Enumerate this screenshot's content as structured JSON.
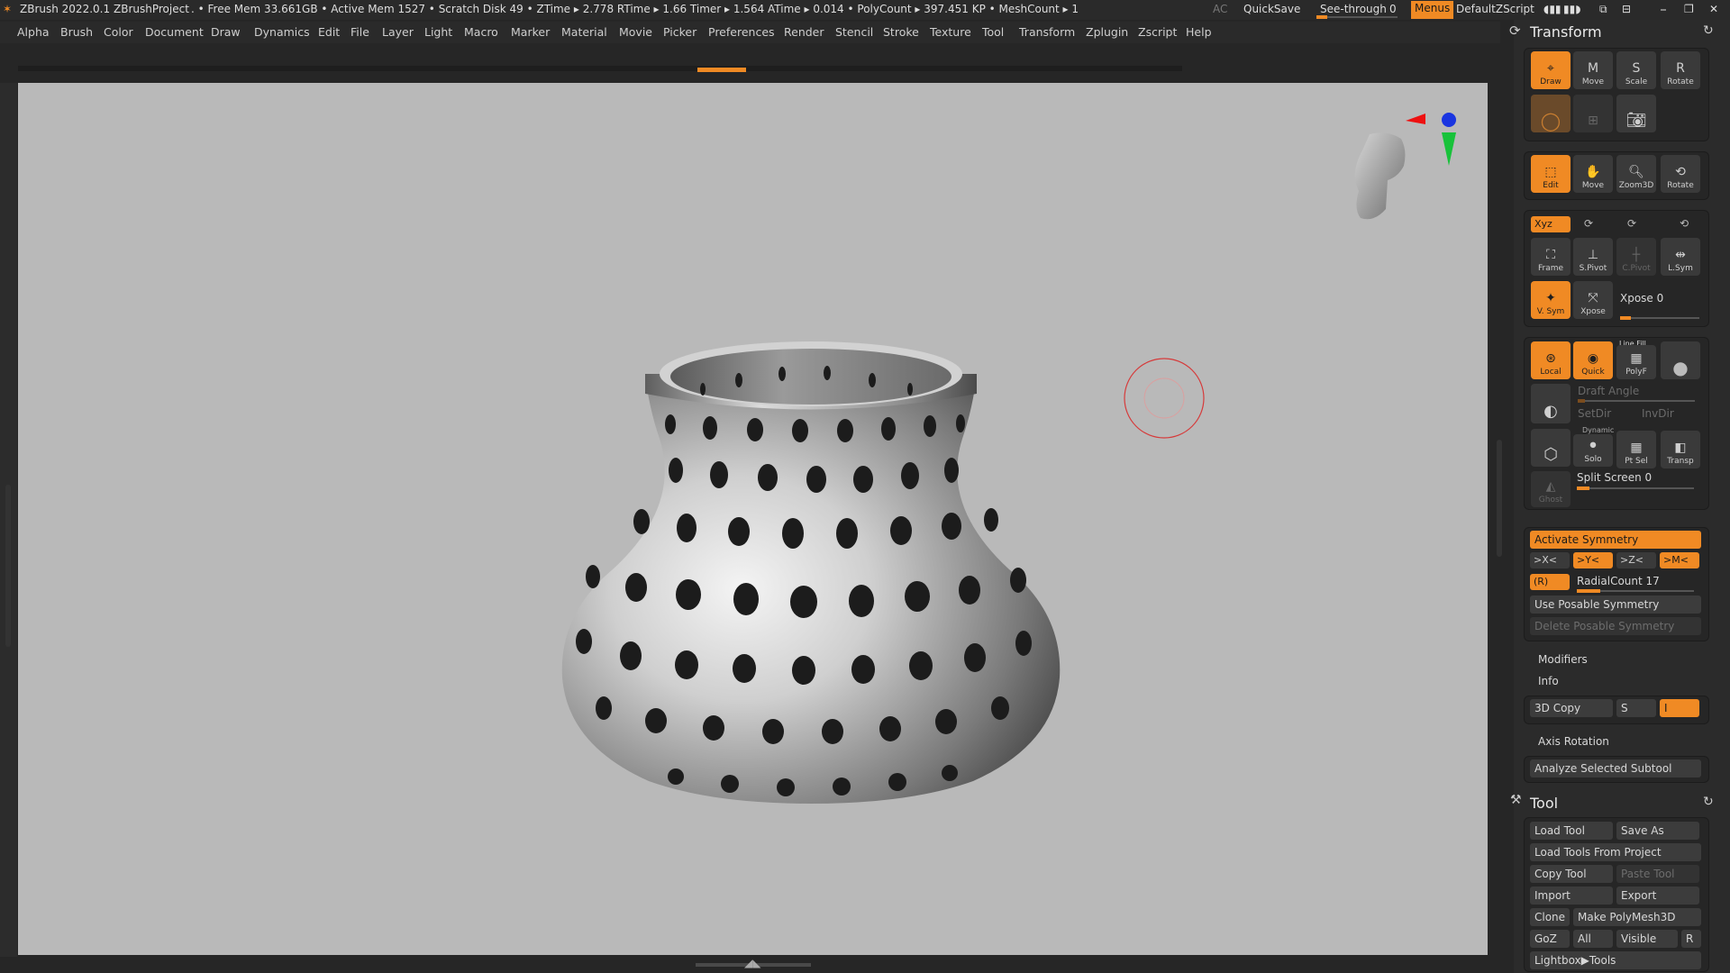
{
  "titlebar": {
    "app": "ZBrush 2022.0.1",
    "project": "ZBrushProject",
    "stats": ". • Free Mem 33.661GB • Active Mem 1527 • Scratch Disk 49 • ZTime ▸ 2.778 RTime ▸ 1.66 Timer ▸ 1.564 ATime ▸ 0.014 • PolyCount ▸ 397.451 KP • MeshCount ▸ 1",
    "ac": "AC",
    "quicksave": "QuickSave",
    "seethrough_label": "See-through",
    "seethrough_value": "0",
    "menus": "Menus",
    "default_zscript": "DefaultZScript"
  },
  "menubar": [
    "Alpha",
    "Brush",
    "Color",
    "Document",
    "Draw",
    "Dynamics",
    "Edit",
    "File",
    "Layer",
    "Light",
    "Macro",
    "Marker",
    "Material",
    "Movie",
    "Picker",
    "Preferences",
    "Render",
    "Stencil",
    "Stroke",
    "Texture",
    "Tool",
    "Transform",
    "Zplugin",
    "Zscript",
    "Help"
  ],
  "colors": {
    "accent": "#f08a24",
    "viewport": "#b9b9b9",
    "panel": "#2b2b2b",
    "brush_ring": "#d63a3a"
  },
  "transform": {
    "title": "Transform",
    "row1": {
      "draw": "Draw",
      "move": "Move",
      "scale": "Scale",
      "rotate": "Rotate"
    },
    "row3": {
      "edit": "Edit",
      "move": "Move",
      "zoom3d": "Zoom3D",
      "rotate": "Rotate"
    },
    "xyz": "Xyz",
    "row4": {
      "frame": "Frame",
      "spivot": "S.Pivot",
      "cpivot": "C.Pivot",
      "lsym": "L.Sym"
    },
    "row5": {
      "vsym": "V. Sym",
      "xpose": "Xpose",
      "xpose_slider": "Xpose 0"
    },
    "row6": {
      "local": "Local",
      "quick": "Quick",
      "linefill": "Line Fill",
      "polyf": "PolyF"
    },
    "draft_angle": "Draft Angle",
    "setdir": "SetDir",
    "invdir": "InvDir",
    "dynamic": "Dynamic",
    "solo": "Solo",
    "ptsel": "Pt Sel",
    "transp": "Transp",
    "ghost": "Ghost",
    "split_screen": "Split Screen 0",
    "activate_symmetry": "Activate Symmetry",
    "axes": [
      "&gt;X&lt;",
      ">Y<",
      ">Z<",
      ">M<"
    ],
    "r": "(R)",
    "radial_count": "RadialCount 17",
    "use_posable": "Use Posable Symmetry",
    "delete_posable": "Delete Posable Symmetry",
    "modifiers": "Modifiers",
    "info": "Info",
    "copy3d": "3D Copy",
    "s": "S",
    "i": "I",
    "axis_rotation": "Axis Rotation",
    "analyze": "Analyze Selected Subtool"
  },
  "tool": {
    "title": "Tool",
    "load_tool": "Load Tool",
    "save_as": "Save As",
    "load_from_project": "Load Tools From Project",
    "copy_tool": "Copy Tool",
    "paste_tool": "Paste Tool",
    "import": "Import",
    "export": "Export",
    "clone": "Clone",
    "make_polymesh": "Make PolyMesh3D",
    "goz": "GoZ",
    "all": "All",
    "visible": "Visible",
    "r": "R",
    "lightbox_tools": "Lightbox▶Tools"
  }
}
